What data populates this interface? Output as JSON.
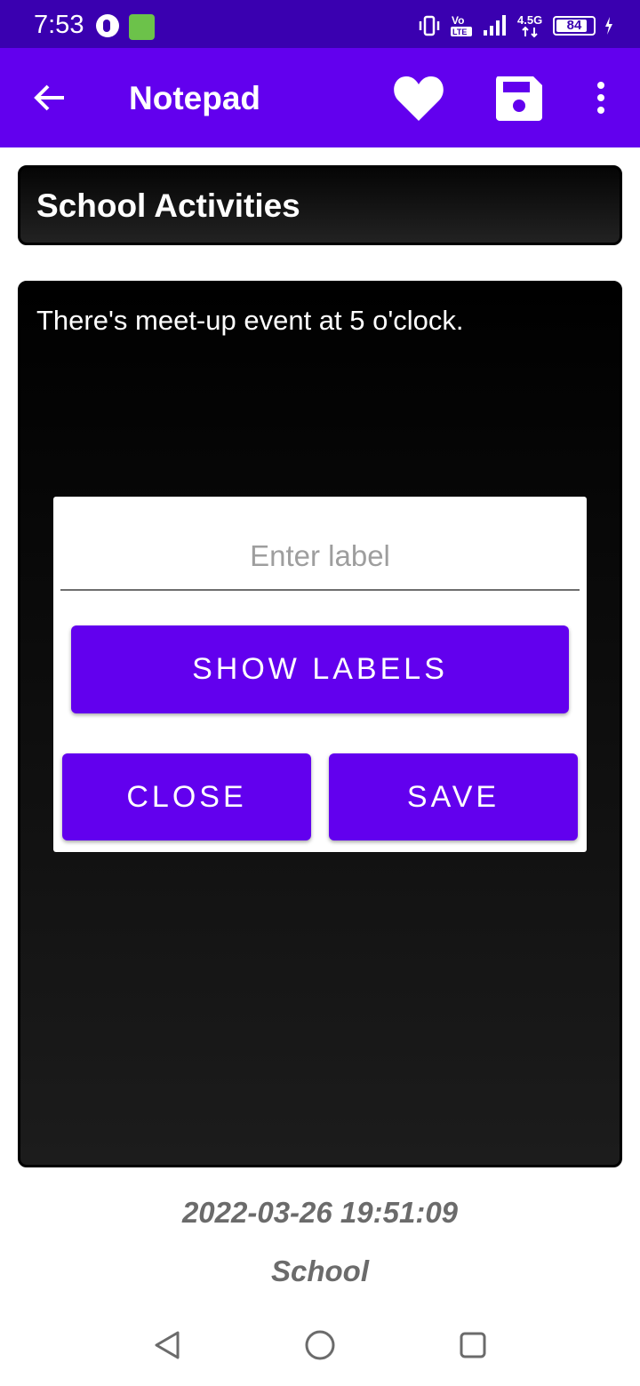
{
  "status_bar": {
    "time": "7:53",
    "network": "4.5G",
    "volte": "Vo LTE",
    "battery_level": "84",
    "battery_fraction": 0.84
  },
  "app_bar": {
    "title": "Notepad",
    "icons": [
      "arrow-back-icon",
      "heart-icon",
      "floppy-save-icon",
      "more-vert-icon"
    ],
    "background": "#6200ee"
  },
  "note": {
    "title": "School Activities",
    "body": "There's meet-up event at 5 o'clock."
  },
  "dialog": {
    "label_placeholder": "Enter label",
    "label_value": "",
    "show_labels_button": "SHOW LABELS",
    "close_button": "CLOSE",
    "save_button": "SAVE"
  },
  "footer": {
    "timestamp": "2022-03-26 19:51:09",
    "label": "School"
  },
  "colors": {
    "accent": "#6200ee",
    "status_bar": "#3a00b0",
    "footer_text": "#6b6b6b"
  }
}
